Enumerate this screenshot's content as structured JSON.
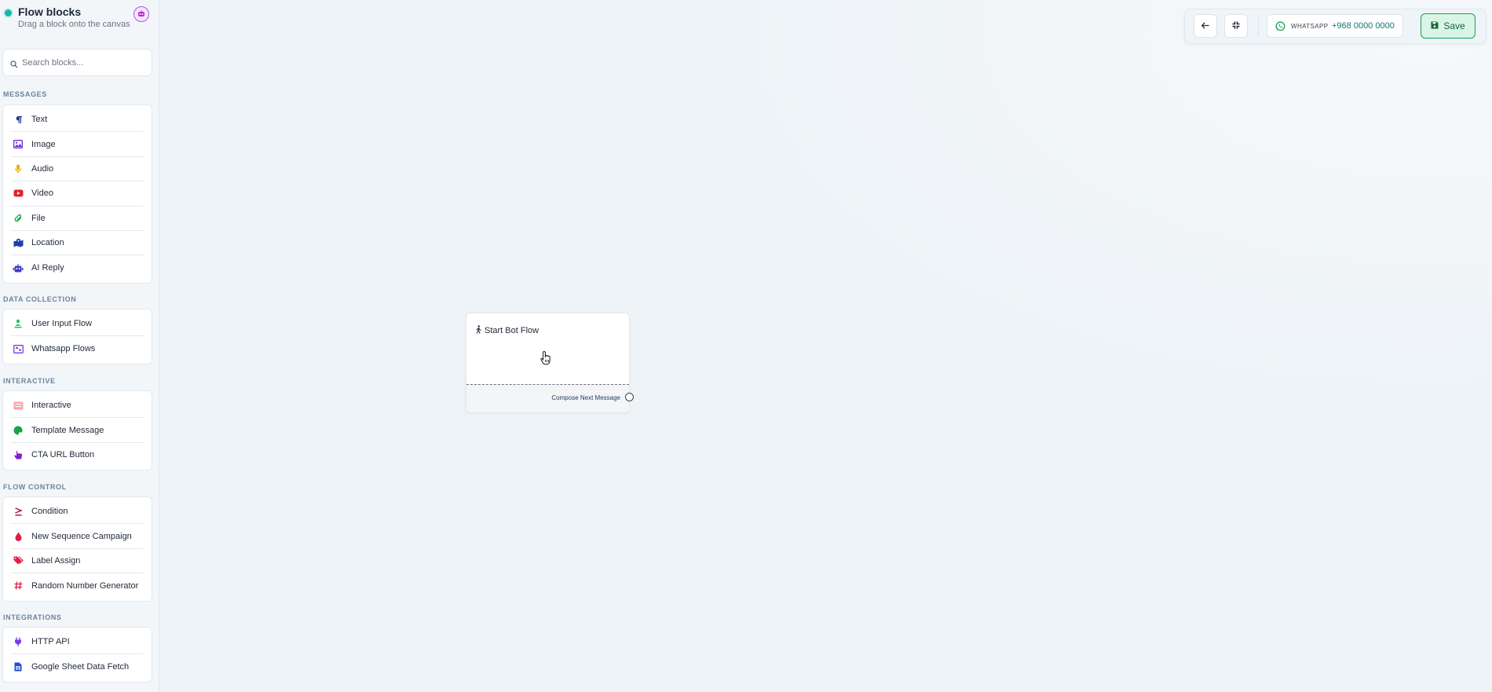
{
  "sidebar": {
    "title": "Flow blocks",
    "subtitle": "Drag a block onto the canvas",
    "avatar_icon": "bot-avatar-icon",
    "search": {
      "placeholder": "Search blocks..."
    },
    "sections": [
      {
        "label": "MESSAGES",
        "items": [
          {
            "label": "Text",
            "icon": "paragraph-icon",
            "color": "#1e3a8a"
          },
          {
            "label": "Image",
            "icon": "image-icon",
            "color": "#6d28d9"
          },
          {
            "label": "Audio",
            "icon": "microphone-icon",
            "color": "#eab308"
          },
          {
            "label": "Video",
            "icon": "video-icon",
            "color": "#dc2626"
          },
          {
            "label": "File",
            "icon": "paperclip-icon",
            "color": "#16a34a"
          },
          {
            "label": "Location",
            "icon": "map-location-icon",
            "color": "#1e40af"
          },
          {
            "label": "AI Reply",
            "icon": "robot-icon",
            "color": "#4338ca"
          }
        ]
      },
      {
        "label": "DATA COLLECTION",
        "items": [
          {
            "label": "User Input Flow",
            "icon": "user-input-icon",
            "color": "#22c55e"
          },
          {
            "label": "Whatsapp Flows",
            "icon": "whatsapp-flows-icon",
            "color": "#7c3aed"
          }
        ]
      },
      {
        "label": "INTERACTIVE",
        "items": [
          {
            "label": "Interactive",
            "icon": "list-card-icon",
            "color": "#ef4444"
          },
          {
            "label": "Template Message",
            "icon": "palette-icon",
            "color": "#16a34a"
          },
          {
            "label": "CTA URL Button",
            "icon": "hand-pointer-icon",
            "color": "#7e22ce"
          }
        ]
      },
      {
        "label": "FLOW CONTROL",
        "items": [
          {
            "label": "Condition",
            "icon": "greater-equal-icon",
            "color": "#9f1239"
          },
          {
            "label": "New Sequence Campaign",
            "icon": "droplet-icon",
            "color": "#e11d48"
          },
          {
            "label": "Label Assign",
            "icon": "tags-icon",
            "color": "#e11d48"
          },
          {
            "label": "Random Number Generator",
            "icon": "hashtag-icon",
            "color": "#e11d48"
          }
        ]
      },
      {
        "label": "INTEGRATIONS",
        "items": [
          {
            "label": "HTTP API",
            "icon": "plug-icon",
            "color": "#7c3aed"
          },
          {
            "label": "Google Sheet Data Fetch",
            "icon": "spreadsheet-icon",
            "color": "#1d4ed8"
          }
        ]
      }
    ]
  },
  "toolbar": {
    "back_icon": "arrow-left-icon",
    "fit_icon": "compress-icon",
    "whatsapp_label": "WHATSAPP",
    "whatsapp_number": "+968 0000 0000",
    "save_label": "Save",
    "accent": "#16a34a"
  },
  "canvas": {
    "start_node": {
      "title": "Start Bot Flow",
      "icon": "person-walking-icon",
      "cursor_icon": "hand-cursor-icon",
      "footer_label": "Compose Next Message"
    }
  }
}
